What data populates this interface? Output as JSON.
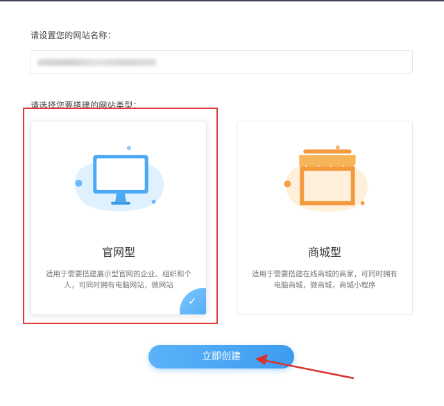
{
  "form": {
    "name_label": "请设置您的网站名称：",
    "name_value_hidden": "",
    "type_label": "请选择您要搭建的网站类型："
  },
  "cards": [
    {
      "title": "官网型",
      "description": "适用于需要搭建展示型官网的企业、组织和个人，可同时拥有电脑网站，微网站",
      "icon": "monitor-icon",
      "selected": true
    },
    {
      "title": "商城型",
      "description": "适用于需要搭建在线商城的商家，可同时拥有电脑商城，微商城，商城小程序",
      "icon": "storefront-icon",
      "selected": false
    }
  ],
  "actions": {
    "create_label": "立即创建"
  },
  "colors": {
    "accent": "#3d9cf0",
    "highlight": "#e03a3a",
    "mall_orange": "#f7a54a"
  }
}
